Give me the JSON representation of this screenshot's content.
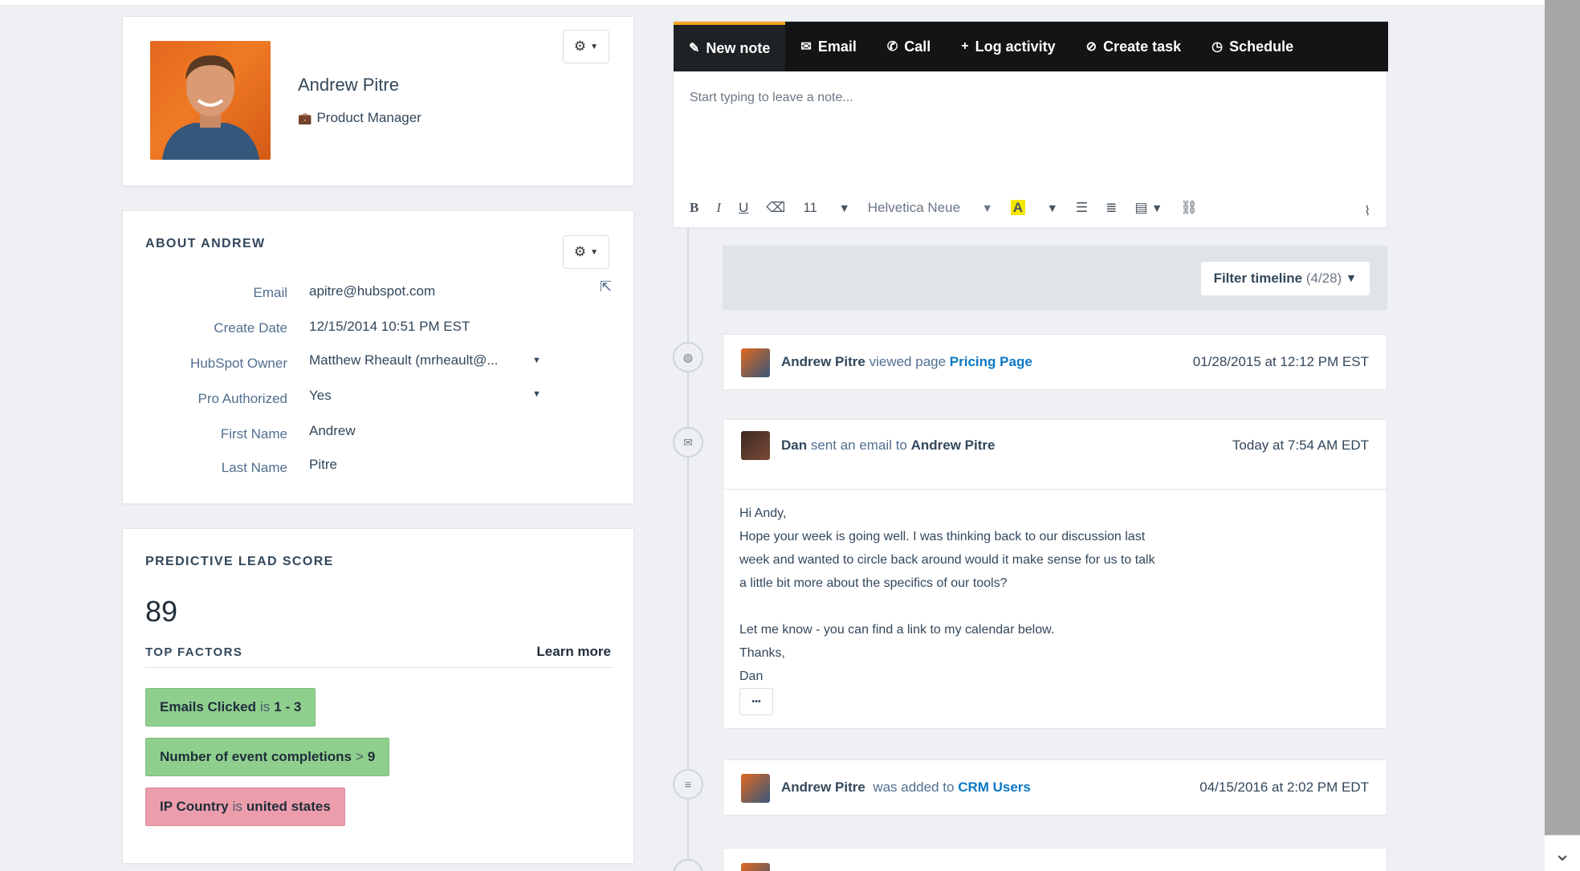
{
  "profile": {
    "name": "Andrew Pitre",
    "job_title": "Product Manager"
  },
  "about": {
    "title": "ABOUT ANDREW",
    "fields": [
      {
        "label": "Email",
        "value": "apitre@hubspot.com"
      },
      {
        "label": "Create Date",
        "value": "12/15/2014 10:51 PM EST"
      },
      {
        "label": "HubSpot Owner",
        "value": "Matthew Rheault (mrheault@..."
      },
      {
        "label": "Pro Authorized",
        "value": "Yes"
      },
      {
        "label": "First Name",
        "value": "Andrew"
      },
      {
        "label": "Last Name",
        "value": "Pitre"
      }
    ]
  },
  "lead_score": {
    "title": "PREDICTIVE LEAD SCORE",
    "score": "89",
    "factors_title": "TOP FACTORS",
    "learn_more": "Learn more",
    "factors": [
      {
        "field": "Emails Clicked",
        "op": "is",
        "value": "1 - 3"
      },
      {
        "field": "Number of event completions",
        "op": ">",
        "value": "9"
      },
      {
        "field": "IP Country",
        "op": "is",
        "value": "united states"
      }
    ]
  },
  "composer": {
    "tabs": [
      {
        "label": "New note",
        "icon": "edit-icon"
      },
      {
        "label": "Email",
        "icon": "envelope-icon"
      },
      {
        "label": "Call",
        "icon": "phone-icon"
      },
      {
        "label": "Log activity",
        "icon": "plus-icon"
      },
      {
        "label": "Create task",
        "icon": "check-circle-icon"
      },
      {
        "label": "Schedule",
        "icon": "clock-icon"
      }
    ],
    "placeholder": "Start typing to leave a note...",
    "font_size": "11",
    "font_family": "Helvetica Neue"
  },
  "timeline": {
    "filter_label": "Filter timeline",
    "filter_count": "(4/28)",
    "events": [
      {
        "actor": "Andrew Pitre",
        "action": "viewed page",
        "target": "Pricing Page",
        "time": "01/28/2015 at 12:12 PM EST"
      },
      {
        "actor": "Dan",
        "action": "sent an email to",
        "target": "Andrew Pitre",
        "time": "Today at 7:54 AM EDT",
        "body": [
          "Hi Andy,",
          "Hope your week is going well. I was thinking back to our discussion last",
          "week and wanted to circle back around would it make sense for us to talk",
          "a little bit more about the specifics of our tools?",
          "",
          "Let me know - you can find a link to my calendar below.",
          "Thanks,",
          "Dan"
        ],
        "more": "•••"
      },
      {
        "actor": "Andrew Pitre",
        "action": "was added to",
        "target": "CRM Users",
        "time": "04/15/2016 at 2:02 PM EDT"
      }
    ]
  },
  "colors": {
    "accent_tab": "#f5a623",
    "link": "#0b78c5",
    "factor_green": "#8fcf8e",
    "factor_red": "#ec9dac"
  }
}
